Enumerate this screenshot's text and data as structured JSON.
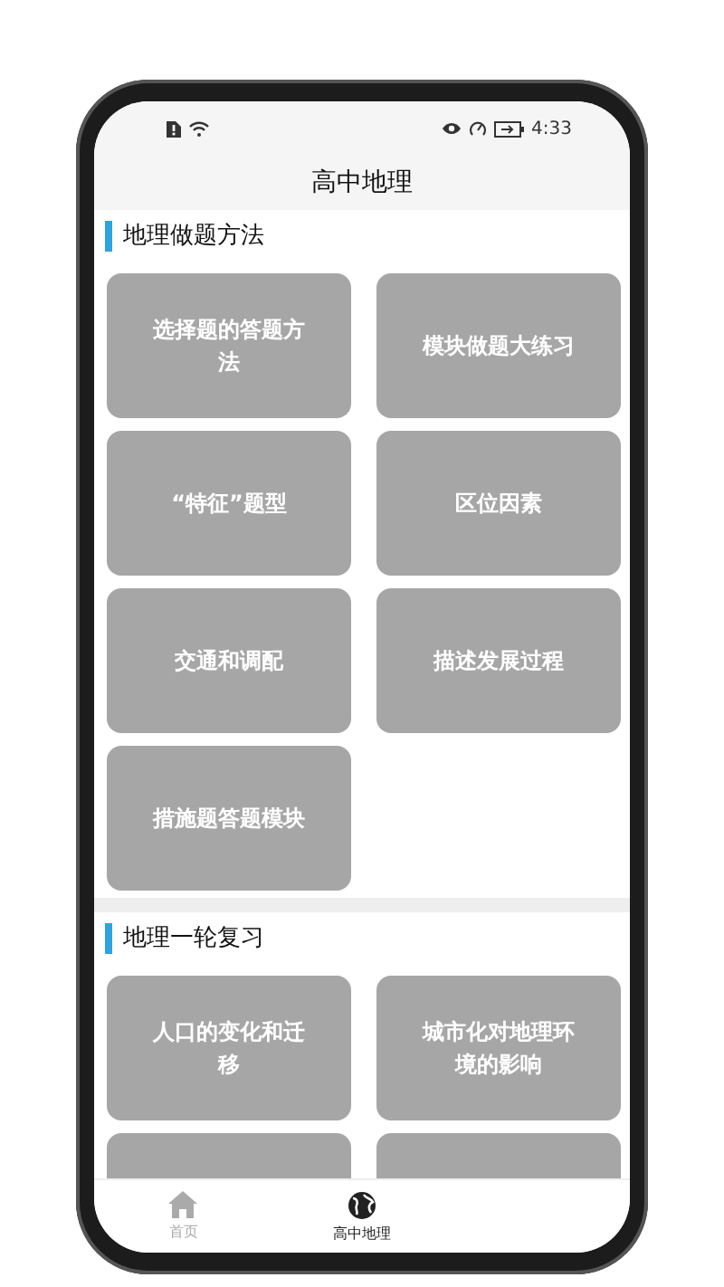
{
  "status_bar": {
    "time": "4:33"
  },
  "title": "高中地理",
  "sections": [
    {
      "heading": "地理做题方法",
      "cards": [
        {
          "kind": "topic",
          "title": "选择题的答题方法"
        },
        {
          "kind": "topic",
          "title": "模块做题大练习"
        },
        {
          "kind": "topic",
          "title": "“特征”题型"
        },
        {
          "kind": "topic",
          "title": "区位因素"
        },
        {
          "kind": "topic",
          "title": "交通和调配"
        },
        {
          "kind": "topic",
          "title": "描述发展过程"
        },
        {
          "kind": "topic",
          "title": "措施题答题模块"
        }
      ]
    },
    {
      "heading": "地理一轮复习",
      "cards": [
        {
          "kind": "topic",
          "title": "人口的变化和迁移"
        },
        {
          "kind": "topic",
          "title": "城市化对地理环境的影响"
        },
        {
          "kind": "cut_off"
        },
        {
          "kind": "cut_off"
        }
      ]
    }
  ],
  "tabs": [
    {
      "label": "首页",
      "kind": "home",
      "selected": false
    },
    {
      "label": "高中地理",
      "kind": "globe",
      "selected": true
    }
  ]
}
